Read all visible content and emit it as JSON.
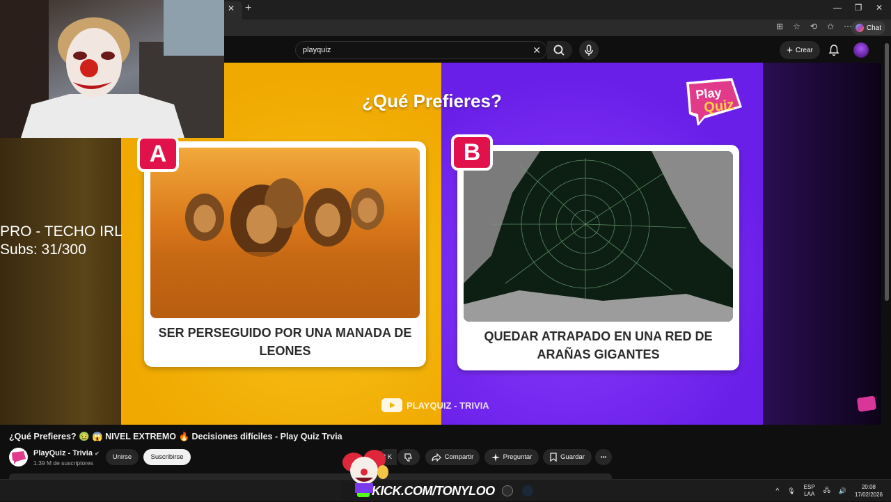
{
  "browser": {
    "tab_close": "✕",
    "new_tab": "+",
    "window_controls": [
      "—",
      "❐",
      "✕"
    ],
    "address_icons": [
      "⊞",
      "☆",
      "⟲",
      "✩",
      "⋯"
    ],
    "chat_label": "Chat"
  },
  "youtube": {
    "search_value": "playquiz",
    "search_clear": "✕",
    "create_label": "Crear",
    "create_icon": "+"
  },
  "video": {
    "title": "¿Qué Prefieres?",
    "logo_line1": "Play",
    "logo_line2": "Quiz",
    "option_a": {
      "letter": "A",
      "text": "SER PERSEGUIDO POR UNA MANADA DE LEONES"
    },
    "option_b": {
      "letter": "B",
      "text": "QUEDAR ATRAPADO EN UNA RED DE ARAÑAS GIGANTES"
    },
    "watermark": "PLAYQUIZ - TRIVIA",
    "overlay_line1": "PRO - TECHO IRL",
    "overlay_line2": "Subs: 31/300"
  },
  "details": {
    "video_title": "¿Qué Prefieres? 🤢 😱 NIVEL EXTREMO 🔥 Decisiones difíciles - Play Quiz Trvia",
    "channel_name": "PlayQuiz - Trivia",
    "verified_icon": "✔",
    "subscribers": "1.39 M de suscriptores",
    "join_label": "Unirse",
    "subscribe_label": "Suscribirse",
    "like_count": "8 K",
    "share_label": "Compartir",
    "ask_label": "Preguntar",
    "save_label": "Guardar",
    "more_label": "•••"
  },
  "taskbar": {
    "kick_text": "KICK.COM/TONYLOO",
    "kick_letter": "K",
    "lang_top": "ESP",
    "lang_bottom": "LAA",
    "time": "20:08",
    "date": "17/02/2026",
    "tray_icons": [
      "^",
      "🎙",
      "🖧",
      "🔊"
    ]
  },
  "colors": {
    "yellow": "#f5b800",
    "purple": "#7a2ff5",
    "badge_red": "#e1124b",
    "kick_green": "#53fc18"
  }
}
